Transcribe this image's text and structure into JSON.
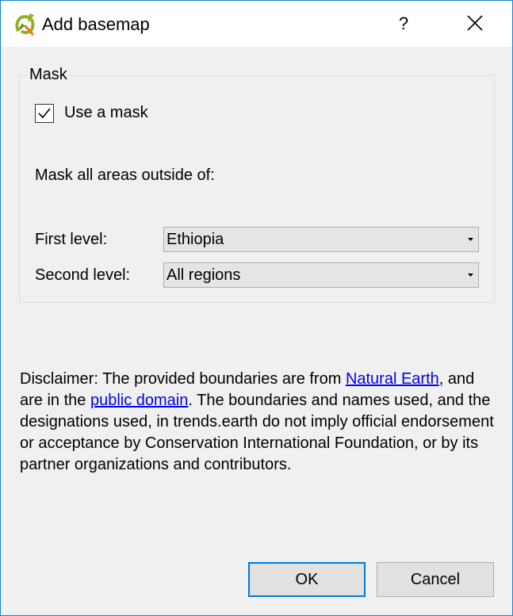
{
  "window": {
    "title": "Add basemap",
    "help_label": "?"
  },
  "mask_group": {
    "title": "Mask",
    "use_mask_label": "Use a mask",
    "use_mask_checked": true,
    "description": "Mask all areas outside of:",
    "first_level": {
      "label": "First level:",
      "value": "Ethiopia"
    },
    "second_level": {
      "label": "Second level:",
      "value": "All regions"
    }
  },
  "disclaimer": {
    "part1": "Disclaimer: The provided boundaries are from ",
    "link1": "Natural Earth",
    "part2": ", and are in the ",
    "link2": "public domain",
    "part3": ". The boundaries and names used, and the designations used, in trends.earth do not imply official endorsement or acceptance by Conservation International Foundation, or by its partner organizations and contributors."
  },
  "buttons": {
    "ok": "OK",
    "cancel": "Cancel"
  },
  "icons": {
    "app": "qgis-logo-icon",
    "close": "close-icon",
    "check": "checkmark-icon",
    "dropdown": "chevron-down-icon"
  },
  "colors": {
    "accent": "#0078d7",
    "link": "#0000ee",
    "window_border": "#1883d7",
    "background": "#f0f0f0"
  }
}
